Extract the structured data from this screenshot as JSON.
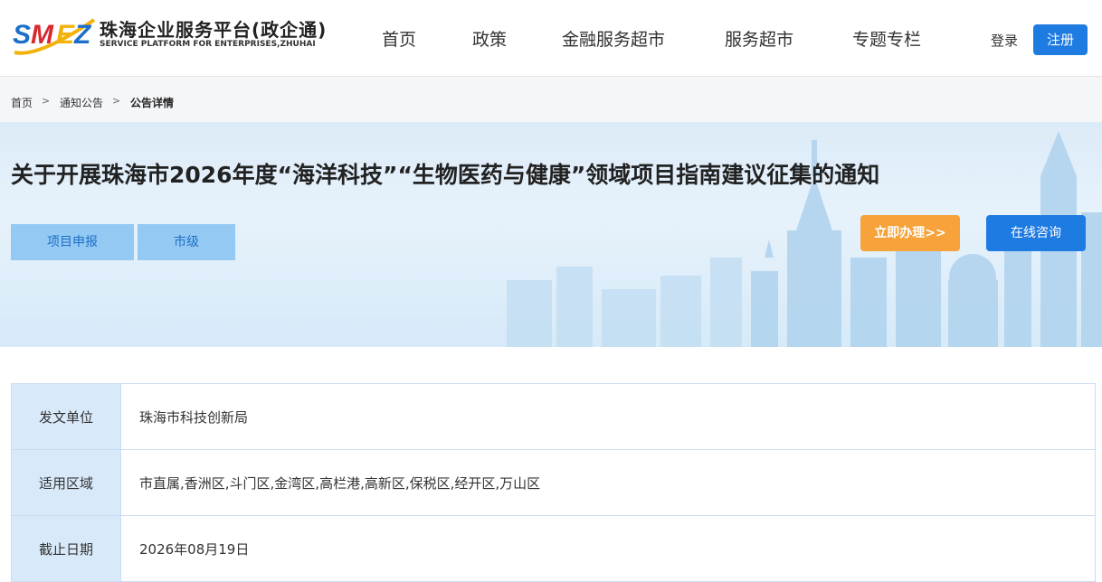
{
  "header": {
    "logo_cn": "珠海企业服务平台(政企通)",
    "logo_en": "SERVICE PLATFORM FOR ENTERPRISES,ZHUHAI",
    "logo_letters": "SMEZ",
    "nav": [
      "首页",
      "政策",
      "金融服务超市",
      "服务超市",
      "专题专栏"
    ],
    "login_label": "登录",
    "register_label": "注册"
  },
  "breadcrumb": {
    "items": [
      "首页",
      "通知公告",
      "公告详情"
    ],
    "separator": ">"
  },
  "notice": {
    "title": "关于开展珠海市2026年度“海洋科技”“生物医药与健康”领域项目指南建议征集的通知",
    "tags": [
      "项目申报",
      "市级"
    ],
    "apply_label": "立即办理>>",
    "consult_label": "在线咨询"
  },
  "details": {
    "rows": [
      {
        "label": "发文单位",
        "value": "珠海市科技创新局"
      },
      {
        "label": "适用区域",
        "value": "市直属,香洲区,斗门区,金湾区,高栏港,高新区,保税区,经开区,万山区"
      },
      {
        "label": "截止日期",
        "value": "2026年08月19日"
      }
    ]
  },
  "colors": {
    "primary": "#1e7be2",
    "accent_orange": "#f7a23a",
    "tag_bg": "#94c9f3",
    "label_bg": "#d8e9f9"
  }
}
